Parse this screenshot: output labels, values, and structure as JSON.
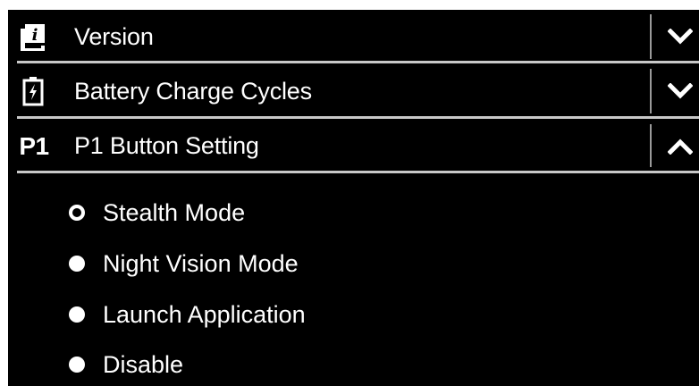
{
  "sections": [
    {
      "label": "Version",
      "icon": "version-info-icon",
      "expanded": false,
      "chevron": "chevron-down-icon"
    },
    {
      "label": "Battery Charge Cycles",
      "icon": "battery-charge-icon",
      "expanded": false,
      "chevron": "chevron-down-icon"
    },
    {
      "label": "P1 Button Setting",
      "icon_text": "P1",
      "icon": "p1-badge-icon",
      "expanded": true,
      "chevron": "chevron-up-icon"
    }
  ],
  "p1_options": {
    "selected": "Stealth Mode",
    "items": [
      {
        "label": "Stealth Mode",
        "selected": true
      },
      {
        "label": "Night Vision Mode",
        "selected": false
      },
      {
        "label": "Launch Application",
        "selected": false
      },
      {
        "label": "Disable",
        "selected": false
      }
    ]
  },
  "colors": {
    "background": "#000000",
    "text": "#ffffff",
    "separator": "#c8c8c8"
  }
}
